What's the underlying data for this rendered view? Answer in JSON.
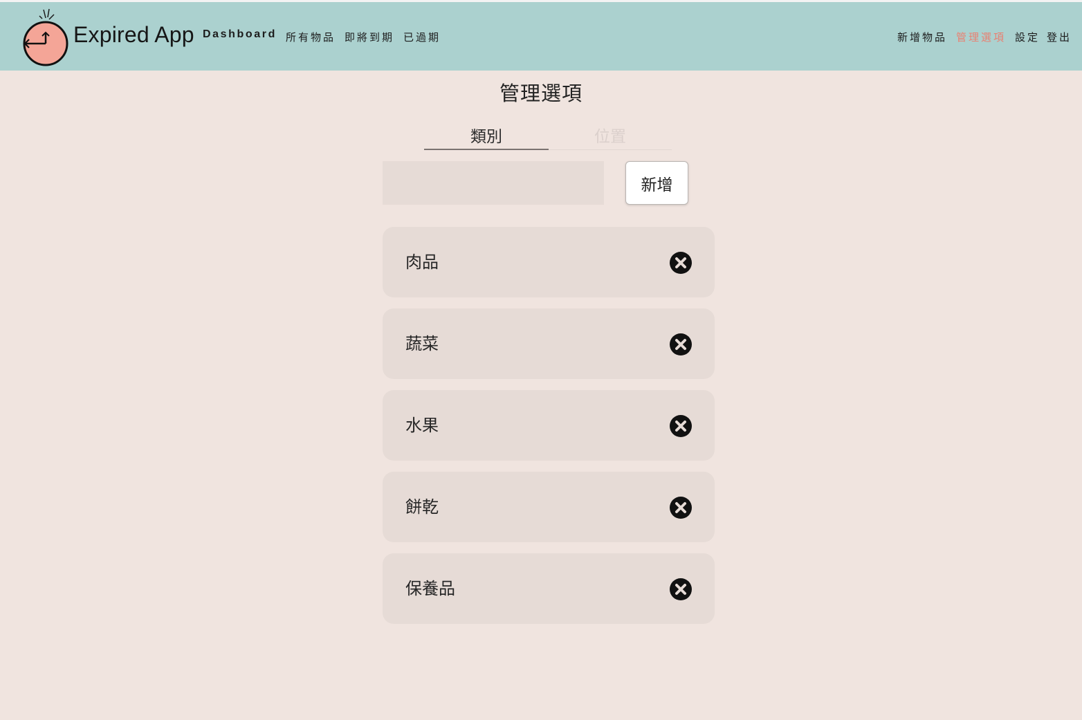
{
  "app": {
    "brand": "Expired App",
    "logo_icon": "clock-icon",
    "colors": {
      "navbar_bg": "#abd1cf",
      "page_bg": "#f0e4df",
      "active_link": "#e98071",
      "logo_fill": "#f4a597"
    }
  },
  "nav": {
    "left": [
      {
        "label": "Dashboard"
      },
      {
        "label": "所有物品"
      },
      {
        "label": "即將到期"
      },
      {
        "label": "已過期"
      }
    ],
    "right": [
      {
        "label": "新增物品",
        "active": false
      },
      {
        "label": "管理選項",
        "active": true
      },
      {
        "label": "設定",
        "active": false
      },
      {
        "label": "登出",
        "active": false
      }
    ]
  },
  "page": {
    "title": "管理選項",
    "tabs": [
      {
        "label": "類別",
        "active": true
      },
      {
        "label": "位置",
        "active": false
      }
    ],
    "new_input": {
      "value": "",
      "placeholder": ""
    },
    "add_button": "新增",
    "delete_icon": "close-circle-icon",
    "items": [
      {
        "label": "肉品"
      },
      {
        "label": "蔬菜"
      },
      {
        "label": "水果"
      },
      {
        "label": "餅乾"
      },
      {
        "label": "保養品"
      }
    ]
  }
}
